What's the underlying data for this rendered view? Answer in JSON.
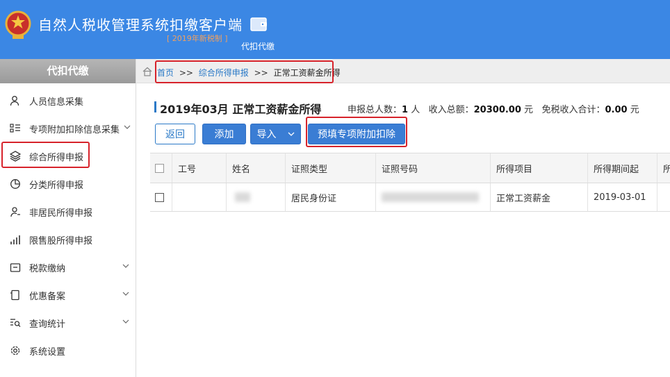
{
  "header": {
    "title": "自然人税收管理系统扣缴客户端",
    "subtitle": "[ 2019年新税制 ]",
    "module": {
      "label": "代扣代缴",
      "icon": "wallet-icon"
    }
  },
  "sidebar": {
    "title": "代扣代缴",
    "items": [
      {
        "label": "人员信息采集",
        "icon": "person-icon"
      },
      {
        "label": "专项附加扣除信息采集",
        "icon": "list-icon",
        "expandable": true
      },
      {
        "label": "综合所得申报",
        "icon": "layers-icon",
        "active": true
      },
      {
        "label": "分类所得申报",
        "icon": "pie-icon"
      },
      {
        "label": "非居民所得申报",
        "icon": "person-outline-icon"
      },
      {
        "label": "限售股所得申报",
        "icon": "bar-chart-icon"
      },
      {
        "label": "税款缴纳",
        "icon": "folder-icon",
        "expandable": true
      },
      {
        "label": "优惠备案",
        "icon": "document-icon",
        "expandable": true
      },
      {
        "label": "查询统计",
        "icon": "search-list-icon",
        "expandable": true
      },
      {
        "label": "系统设置",
        "icon": "gear-icon"
      }
    ]
  },
  "breadcrumb": {
    "home": "首页",
    "sep": ">>",
    "level1": "综合所得申报",
    "current": "正常工资薪金所得"
  },
  "main": {
    "title": "2019年03月  正常工资薪金所得",
    "summary": {
      "count_label": "申报总人数：",
      "count_value": "1",
      "count_unit": "人",
      "income_label": "收入总额：",
      "income_value": "20300.00",
      "income_unit": "元",
      "exempt_label": "免税收入合计：",
      "exempt_value": "0.00",
      "exempt_unit": "元"
    },
    "buttons": {
      "back": "返回",
      "add": "添加",
      "import": "导入",
      "prefill": "预填专项附加扣除"
    },
    "table": {
      "columns": [
        "工号",
        "姓名",
        "证照类型",
        "证照号码",
        "所得项目",
        "所得期间起",
        "所"
      ],
      "rows": [
        {
          "id_type": "居民身份证",
          "income_item": "正常工资薪金",
          "period_start": "2019-03-01"
        }
      ]
    }
  },
  "colors": {
    "header_bg": "#3b87e4",
    "accent": "#2a79c7",
    "highlight": "#d7232b"
  }
}
